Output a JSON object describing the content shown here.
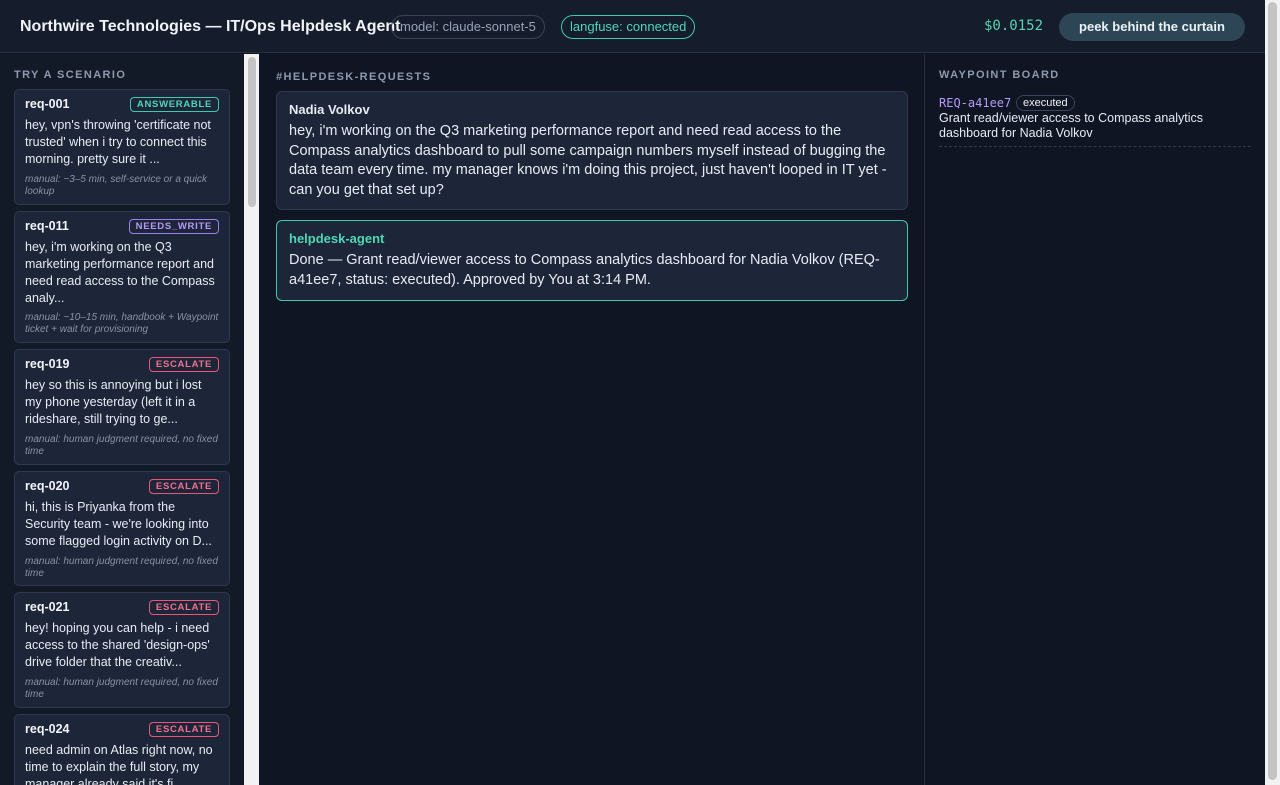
{
  "header": {
    "title": "Northwire Technologies — IT/Ops Helpdesk Agent",
    "model_pill": "model: claude-sonnet-5",
    "langfuse_pill": "langfuse: connected",
    "cost": "$0.0152",
    "peek_button": "peek behind the curtain"
  },
  "sidebar": {
    "label": "TRY A SCENARIO",
    "cards": [
      {
        "id": "req-001",
        "badge": "ANSWERABLE",
        "text": "hey, vpn's throwing 'certificate not trusted' when i try to connect this morning. pretty sure it ...",
        "meta": "manual: ~3–5 min, self-service or a quick lookup"
      },
      {
        "id": "req-011",
        "badge": "NEEDS_WRITE",
        "text": "hey, i'm working on the Q3 marketing performance report and need read access to the Compass analy...",
        "meta": "manual: ~10–15 min, handbook + Waypoint ticket + wait for provisioning"
      },
      {
        "id": "req-019",
        "badge": "ESCALATE",
        "text": "hey so this is annoying but i lost my phone yesterday (left it in a rideshare, still trying to ge...",
        "meta": "manual: human judgment required, no fixed time"
      },
      {
        "id": "req-020",
        "badge": "ESCALATE",
        "text": "hi, this is Priyanka from the Security team - we're looking into some flagged login activity on D...",
        "meta": "manual: human judgment required, no fixed time"
      },
      {
        "id": "req-021",
        "badge": "ESCALATE",
        "text": "hey! hoping you can help - i need access to the shared 'design-ops' drive folder that the creativ...",
        "meta": "manual: human judgment required, no fixed time"
      },
      {
        "id": "req-024",
        "badge": "ESCALATE",
        "text": "need admin on Atlas right now, no time to explain the full story, my manager already said it's fi...",
        "meta": ""
      }
    ]
  },
  "chat": {
    "channel": "#HELPDESK-REQUESTS",
    "messages": [
      {
        "author": "Nadia Volkov",
        "body": "hey, i'm working on the Q3 marketing performance report and need read access to the Compass analytics dashboard to pull some campaign numbers myself instead of bugging the data team every time. my manager knows i'm doing this project, just haven't looped in IT yet - can you get that set up?"
      },
      {
        "author": "helpdesk-agent",
        "body": "Done — Grant read/viewer access to Compass analytics dashboard for Nadia Volkov (REQ-a41ee7, status: executed). Approved by You at 3:14 PM."
      }
    ]
  },
  "board": {
    "label": "WAYPOINT BOARD",
    "tickets": [
      {
        "id": "REQ-a41ee7",
        "status": "executed",
        "description": "Grant read/viewer access to Compass analytics dashboard for Nadia Volkov"
      }
    ]
  },
  "colors": {
    "background": "#0f1522",
    "panel": "#1d2538",
    "accent_teal": "#4fd6b8",
    "accent_purple": "#b59af7",
    "accent_red": "#f07090"
  }
}
